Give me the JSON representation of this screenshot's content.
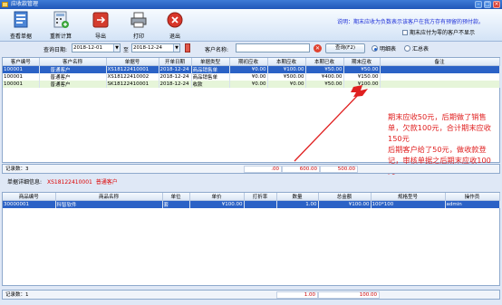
{
  "window": {
    "title": "应收款管理"
  },
  "toolbar": {
    "buttons": [
      {
        "label": "查看单据",
        "icon": "view-document-icon"
      },
      {
        "label": "重新计算",
        "icon": "recalculate-icon"
      },
      {
        "label": "导出",
        "icon": "export-icon"
      },
      {
        "label": "打印",
        "icon": "print-icon"
      },
      {
        "label": "退出",
        "icon": "exit-icon"
      }
    ],
    "note": "说明：期末应收为负数表示该客户在我方存有预留的预付款。",
    "hide_zero_label": "期末应付为零的客户不显示"
  },
  "filter": {
    "date_label": "查询日期:",
    "date_from": "2018-12-01",
    "to_label": "至",
    "date_to": "2018-12-24",
    "customer_label": "客户名称:",
    "customer_value": "",
    "query_button": "查询(F2)",
    "radio_detail": "明细表",
    "radio_summary": "汇总表"
  },
  "grid1": {
    "columns": [
      "客户编号",
      "客户名称",
      "单据号",
      "开单日期",
      "单据类型",
      "期初应收",
      "本期应收",
      "本期已收",
      "期末应收",
      "备注"
    ],
    "rows": [
      [
        "100001",
        "普通客户",
        "XS18122410001",
        "2018-12-24",
        "商品销售单",
        "¥0.00",
        "¥100.00",
        "¥50.00",
        "¥50.00",
        ""
      ],
      [
        "100001",
        "普通客户",
        "XS18122410002",
        "2018-12-24",
        "商品销售单",
        "¥0.00",
        "¥500.00",
        "¥400.00",
        "¥150.00",
        ""
      ],
      [
        "100001",
        "普通客户",
        "SK18122410001",
        "2018-12-24",
        "收款",
        "¥0.00",
        "¥0.00",
        "¥50.00",
        "¥100.00",
        ""
      ]
    ],
    "footer": {
      "record_label": "记录数：3",
      "sum_begin": ".00",
      "sum_current": "600.00",
      "sum_received": "500.00"
    }
  },
  "detail": {
    "label": "单据详细信息:",
    "doc_no": "XS18122410001",
    "customer": "普通客户"
  },
  "grid2": {
    "columns": [
      "商品编号",
      "商品名称",
      "单位",
      "单价",
      "打折率",
      "数量",
      "总金额",
      "规格型号",
      "操作员"
    ],
    "rows": [
      [
        "30000001",
        "科智软件",
        "套",
        "¥100.00",
        "",
        "1.00",
        "¥100.00",
        "100*100",
        "admin"
      ]
    ],
    "footer": {
      "record_label": "记录数：1",
      "sum_qty": "1.00",
      "sum_amount": "100.00"
    }
  },
  "annotation": {
    "text": "期末应收50元，后期做了销售单，欠款100元，合计期末应收150元\n后期客户给了50元，做收款登记，审核单据之后期末应收100元"
  },
  "colors": {
    "selected_row": "#2b62c6",
    "annotation": "#e02020",
    "note": "#1e30d8"
  }
}
